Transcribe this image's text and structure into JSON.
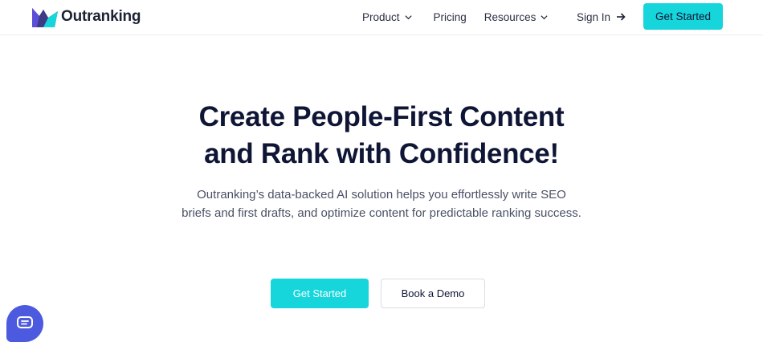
{
  "brand": {
    "name": "Outranking",
    "colors": {
      "accent": "#16d6dc",
      "logo_dark": "#2d2b5f",
      "logo_purple": "#5b4fd8",
      "chat": "#4c5ae0"
    }
  },
  "nav": {
    "items": [
      {
        "label": "Product",
        "dropdown": true
      },
      {
        "label": "Pricing",
        "dropdown": false
      },
      {
        "label": "Resources",
        "dropdown": true
      }
    ],
    "sign_in": "Sign In",
    "get_started": "Get Started"
  },
  "hero": {
    "title_line1": "Create People-First Content",
    "title_line2": "and Rank with Confidence!",
    "subtitle": "Outranking’s data-backed AI solution helps you effortlessly write SEO briefs and first drafts, and optimize content for predictable ranking success.",
    "cta_primary": "Get Started",
    "cta_secondary": "Book a Demo"
  },
  "icons": {
    "logo": "outranking-logo-icon",
    "dropdown": "chevron-down-icon",
    "sign_in_arrow": "arrow-right-icon",
    "chat": "chat-bubble-icon"
  }
}
